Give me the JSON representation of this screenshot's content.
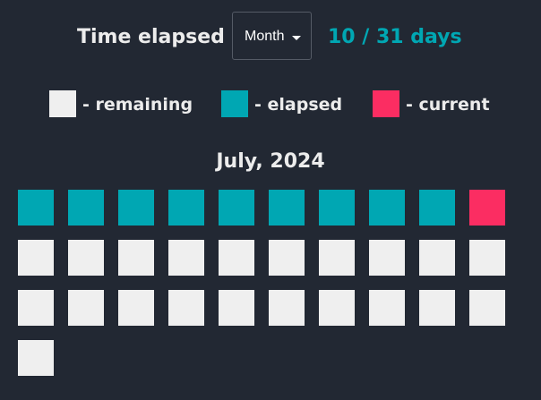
{
  "header": {
    "title": "Time elapsed",
    "period_select": {
      "selected": "Month",
      "icon": "chevron-down-icon"
    },
    "progress_text": "10 / 31 days",
    "elapsed_days": 10,
    "total_days": 31
  },
  "legend": {
    "items": [
      {
        "key": "remaining",
        "label": "- remaining",
        "color": "#efefef"
      },
      {
        "key": "elapsed",
        "label": "- elapsed",
        "color": "#00a7b3"
      },
      {
        "key": "current",
        "label": "- current",
        "color": "#fb2d62"
      }
    ]
  },
  "calendar": {
    "month_title": "July, 2024",
    "days_in_month": 31,
    "elapsed_count": 9,
    "current_day": 10,
    "colors": {
      "background": "#222833",
      "elapsed": "#00a7b3",
      "current": "#fb2d62",
      "remaining": "#efefef"
    }
  }
}
